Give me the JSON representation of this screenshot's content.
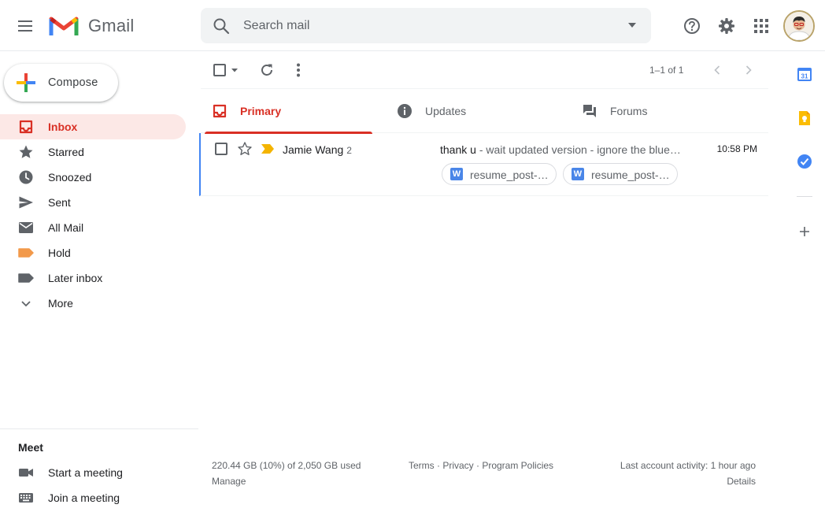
{
  "app": {
    "name": "Gmail"
  },
  "search": {
    "placeholder": "Search mail"
  },
  "compose": {
    "label": "Compose"
  },
  "nav": {
    "items": [
      {
        "label": "Inbox",
        "icon": "inbox-icon",
        "active": true
      },
      {
        "label": "Starred",
        "icon": "star-icon"
      },
      {
        "label": "Snoozed",
        "icon": "clock-icon"
      },
      {
        "label": "Sent",
        "icon": "send-icon"
      },
      {
        "label": "All Mail",
        "icon": "mail-icon"
      },
      {
        "label": "Hold",
        "icon": "label-icon",
        "color": "#f2994a"
      },
      {
        "label": "Later inbox",
        "icon": "label-icon",
        "color": "#5f6368"
      },
      {
        "label": "More",
        "icon": "chevron-down-icon"
      }
    ]
  },
  "meet": {
    "title": "Meet",
    "items": [
      {
        "label": "Start a meeting",
        "icon": "video-icon"
      },
      {
        "label": "Join a meeting",
        "icon": "keyboard-icon"
      }
    ]
  },
  "toolbar": {
    "pager": "1–1 of 1"
  },
  "tabs": [
    {
      "label": "Primary",
      "icon": "inbox-icon",
      "active": true
    },
    {
      "label": "Updates",
      "icon": "info-icon"
    },
    {
      "label": "Forums",
      "icon": "forum-icon"
    }
  ],
  "emails": [
    {
      "sender": "Jamie Wang",
      "count": "2",
      "subject": "thank u",
      "snippet": " - wait updated version - ignore the blue…",
      "time": "10:58 PM",
      "attachments": [
        {
          "name": "resume_post-…",
          "type": "W"
        },
        {
          "name": "resume_post-…",
          "type": "W"
        }
      ]
    }
  ],
  "footer": {
    "storage": "220.44 GB (10%) of 2,050 GB used",
    "manage": "Manage",
    "links": "Terms · Privacy · Program Policies",
    "activity": "Last account activity: 1 hour ago",
    "details": "Details"
  },
  "side_panel": {
    "calendar_date": "31",
    "icons": [
      "calendar-icon",
      "keep-icon",
      "tasks-icon",
      "add-icon"
    ]
  },
  "colors": {
    "accent_red": "#d93025",
    "active_nav_bg": "#fce8e6",
    "label_hold": "#f2994a",
    "importance_marker": "#f4b400"
  }
}
